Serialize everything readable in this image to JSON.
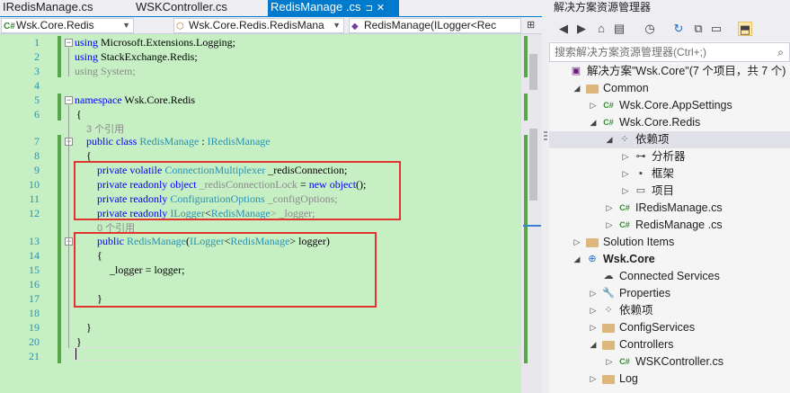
{
  "editor": {
    "tabs": [
      {
        "label": "IRedisManage.cs",
        "pinned": false,
        "active": false
      },
      {
        "label": "WSKController.cs",
        "pinned": false,
        "active": false
      },
      {
        "label": "RedisManage .cs",
        "pinned": true,
        "active": true
      }
    ],
    "tab_pin_glyph": "⊐",
    "tab_close_glyph": "✕",
    "nav": {
      "project": "Wsk.Core.Redis",
      "type": "Wsk.Core.Redis.RedisMana",
      "member": "RedisManage(ILogger<Rec"
    },
    "line_numbers": [
      "1",
      "2",
      "3",
      "4",
      "5",
      "6",
      "7",
      "8",
      "9",
      "10",
      "11",
      "12",
      "13",
      "14",
      "15",
      "16",
      "17",
      "18",
      "19",
      "20",
      "21"
    ],
    "codelens": {
      "class_refs": "3 个引用",
      "ctor_refs": "0 个引用"
    },
    "code": {
      "l1_kw": "using",
      "l1_rest": " Microsoft.Extensions.Logging;",
      "l2_kw": "using",
      "l2_rest": " StackExchange.Redis;",
      "l3_kw": "using",
      "l3_rest": " System;",
      "l5_kw": "namespace",
      "l5_rest": " Wsk.Core.Redis",
      "l6": "{",
      "l7_kw": "public class",
      "l7_name": " RedisManage",
      "l7_sep": " : ",
      "l7_iface": "IRedisManage",
      "l8": "{",
      "l9_kw": "private volatile",
      "l9_type": " ConnectionMultiplexer",
      "l9_rest": " _redisConnection;",
      "l10_kw": "private readonly object",
      "l10_name": " _redisConnectionLock",
      "l10_eq": " = ",
      "l10_new": "new object",
      "l10_end": "();",
      "l11_kw": "private readonly",
      "l11_type": " ConfigurationOptions",
      "l11_rest": " _configOptions;",
      "l12_kw": "private readonly",
      "l12_type": " ILogger",
      "l12_lt": "<",
      "l12_targ": "RedisManage",
      "l12_rest": "> _logger;",
      "l13_kw": "public",
      "l13_name": " RedisManage",
      "l13_p1": "(",
      "l13_t": "ILogger",
      "l13_lt": "<",
      "l13_targ": "RedisManage",
      "l13_rest": "> logger)",
      "l14": "{",
      "l15_a": "_logger",
      "l15_b": " = ",
      "l15_c": "logger",
      "l15_d": ";",
      "l17": "}",
      "l19": "}",
      "l20": "}"
    }
  },
  "solution_explorer": {
    "title": "解决方案资源管理器",
    "search_placeholder": "搜索解决方案资源管理器(Ctrl+;)",
    "search_glyph": "⌕",
    "toolbar_icons": [
      "back-icon",
      "forward-icon",
      "home-icon",
      "solutions-views-icon",
      "history-icon",
      "refresh-icon",
      "collapse-icon",
      "show-all-files-icon"
    ],
    "tree": [
      {
        "label": "解决方案\"Wsk.Core\"(7 个项目，共 7 个)",
        "icon": "solution",
        "expander": "",
        "level": 0,
        "bold": false,
        "selected": false
      },
      {
        "label": "Common",
        "icon": "folder",
        "expander": "◢",
        "level": 1,
        "bold": false,
        "selected": false
      },
      {
        "label": "Wsk.Core.AppSettings",
        "icon": "csproj",
        "expander": "▷",
        "level": 2,
        "bold": false,
        "selected": false
      },
      {
        "label": "Wsk.Core.Redis",
        "icon": "csproj",
        "expander": "◢",
        "level": 2,
        "bold": false,
        "selected": false
      },
      {
        "label": "依赖项",
        "icon": "dependencies",
        "expander": "◢",
        "level": 3,
        "bold": false,
        "selected": true
      },
      {
        "label": "分析器",
        "icon": "analyzer",
        "expander": "▷",
        "level": 4,
        "bold": false,
        "selected": false
      },
      {
        "label": "框架",
        "icon": "framework",
        "expander": "▷",
        "level": 4,
        "bold": false,
        "selected": false
      },
      {
        "label": "项目",
        "icon": "project-ref",
        "expander": "▷",
        "level": 4,
        "bold": false,
        "selected": false
      },
      {
        "label": "IRedisManage.cs",
        "icon": "csfile",
        "expander": "▷",
        "level": 3,
        "bold": false,
        "selected": false
      },
      {
        "label": "RedisManage .cs",
        "icon": "csfile",
        "expander": "▷",
        "level": 3,
        "bold": false,
        "selected": false
      },
      {
        "label": "Solution Items",
        "icon": "folder",
        "expander": "▷",
        "level": 1,
        "bold": false,
        "selected": false
      },
      {
        "label": "Wsk.Core",
        "icon": "webproj",
        "expander": "◢",
        "level": 1,
        "bold": true,
        "selected": false
      },
      {
        "label": "Connected Services",
        "icon": "connected",
        "expander": "",
        "level": 2,
        "bold": false,
        "selected": false
      },
      {
        "label": "Properties",
        "icon": "properties",
        "expander": "▷",
        "level": 2,
        "bold": false,
        "selected": false
      },
      {
        "label": "依赖项",
        "icon": "dependencies",
        "expander": "▷",
        "level": 2,
        "bold": false,
        "selected": false
      },
      {
        "label": "ConfigServices",
        "icon": "folder",
        "expander": "▷",
        "level": 2,
        "bold": false,
        "selected": false
      },
      {
        "label": "Controllers",
        "icon": "folder",
        "expander": "◢",
        "level": 2,
        "bold": false,
        "selected": false
      },
      {
        "label": "WSKController.cs",
        "icon": "csfile",
        "expander": "▷",
        "level": 3,
        "bold": false,
        "selected": false
      },
      {
        "label": "Log",
        "icon": "folder",
        "expander": "▷",
        "level": 2,
        "bold": false,
        "selected": false
      }
    ]
  }
}
